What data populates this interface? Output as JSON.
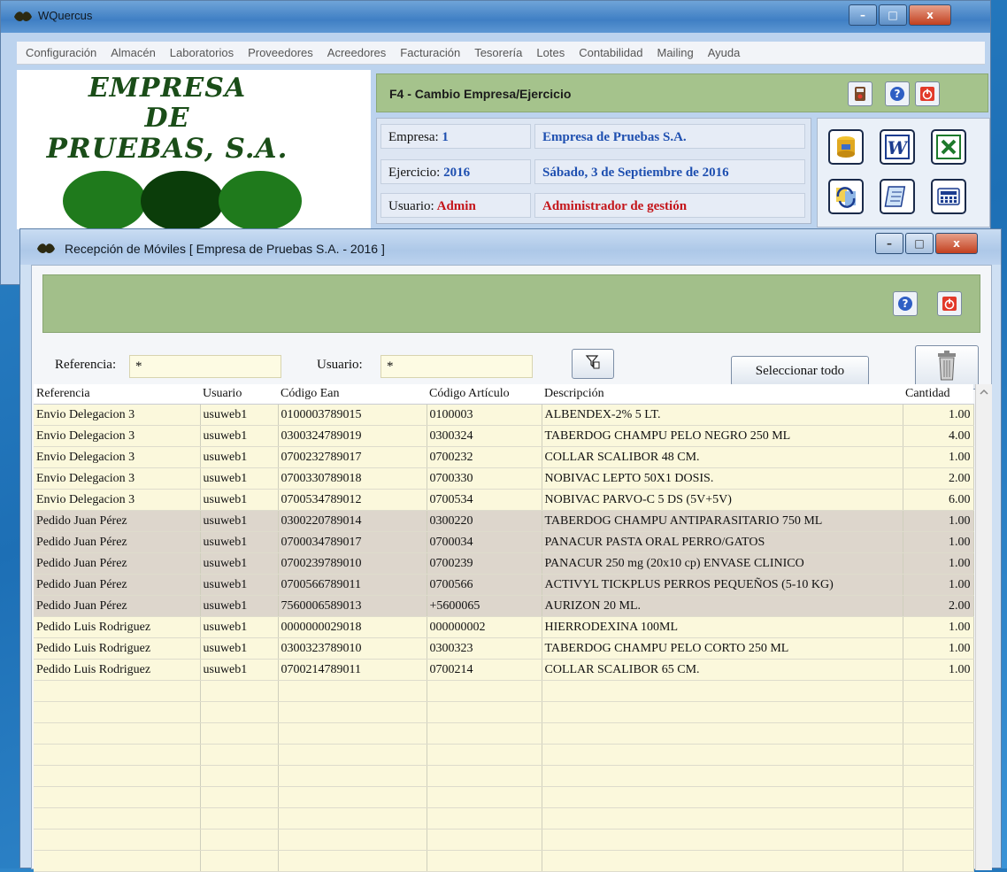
{
  "main_window": {
    "title": "WQuercus",
    "controls": {
      "minimize": "–",
      "maximize": "□",
      "close": "x"
    }
  },
  "menu": [
    "Configuración",
    "Almacén",
    "Laboratorios",
    "Proveedores",
    "Acreedores",
    "Facturación",
    "Tesorería",
    "Lotes",
    "Contabilidad",
    "Mailing",
    "Ayuda"
  ],
  "company_logo": {
    "line1": "EMPRESA",
    "line2": "DE",
    "line3": "PRUEBAS, S.A."
  },
  "header_bar": {
    "label": "F4 - Cambio Empresa/Ejercicio"
  },
  "session": {
    "empresa_label": "Empresa:",
    "empresa_code": "1",
    "empresa_name": "Empresa de Pruebas S.A.",
    "ejercicio_label": "Ejercicio:",
    "ejercicio_value": "2016",
    "fecha": "Sábado, 3 de Septiembre de 2016",
    "usuario_label": "Usuario:",
    "usuario_value": "Admin",
    "usuario_desc": "Administrador de gestión"
  },
  "child_window": {
    "title": "Recepción de Móviles [ Empresa de Pruebas S.A. - 2016 ]"
  },
  "filters": {
    "referencia_label": "Referencia:",
    "referencia_value": "*",
    "usuario_label": "Usuario:",
    "usuario_value": "*",
    "select_all_label": "Seleccionar todo"
  },
  "table": {
    "columns": [
      "Referencia",
      "Usuario",
      "Código Ean",
      "Código Artículo",
      "Descripción",
      "Cantidad"
    ],
    "rows": [
      {
        "group": "del",
        "cells": [
          "Envio Delegacion 3",
          "usuweb1",
          "0100003789015",
          "0100003",
          "ALBENDEX-2% 5 LT.",
          "1.00"
        ]
      },
      {
        "group": "del",
        "cells": [
          "Envio Delegacion 3",
          "usuweb1",
          "0300324789019",
          "0300324",
          "TABERDOG CHAMPU PELO NEGRO 250 ML",
          "4.00"
        ]
      },
      {
        "group": "del",
        "cells": [
          "Envio Delegacion 3",
          "usuweb1",
          "0700232789017",
          "0700232",
          "COLLAR SCALIBOR 48 CM.",
          "1.00"
        ]
      },
      {
        "group": "del",
        "cells": [
          "Envio Delegacion 3",
          "usuweb1",
          "0700330789018",
          "0700330",
          "NOBIVAC LEPTO 50X1 DOSIS.",
          "2.00"
        ]
      },
      {
        "group": "del",
        "cells": [
          "Envio Delegacion 3",
          "usuweb1",
          "0700534789012",
          "0700534",
          "NOBIVAC PARVO-C 5 DS (5V+5V)",
          "6.00"
        ]
      },
      {
        "group": "juan",
        "cells": [
          "Pedido Juan Pérez",
          "usuweb1",
          "0300220789014",
          "0300220",
          "TABERDOG CHAMPU ANTIPARASITARIO 750 ML",
          "1.00"
        ]
      },
      {
        "group": "juan",
        "cells": [
          "Pedido Juan Pérez",
          "usuweb1",
          "0700034789017",
          "0700034",
          "PANACUR PASTA ORAL PERRO/GATOS",
          "1.00"
        ]
      },
      {
        "group": "juan",
        "cells": [
          "Pedido Juan Pérez",
          "usuweb1",
          "0700239789010",
          "0700239",
          "PANACUR 250 mg (20x10 cp) ENVASE CLINICO",
          "1.00"
        ]
      },
      {
        "group": "juan",
        "cells": [
          "Pedido Juan Pérez",
          "usuweb1",
          "0700566789011",
          "0700566",
          "ACTIVYL TICKPLUS PERROS PEQUEÑOS (5-10 KG)",
          "1.00"
        ]
      },
      {
        "group": "juan",
        "cells": [
          "Pedido Juan Pérez",
          "usuweb1",
          "7560006589013",
          "+5600065",
          "AURIZON 20 ML.",
          "2.00"
        ]
      },
      {
        "group": "luis",
        "cells": [
          "Pedido Luis  Rodriguez",
          "usuweb1",
          "0000000029018",
          "000000002",
          "HIERRODEXINA 100ML",
          "1.00"
        ]
      },
      {
        "group": "luis",
        "cells": [
          "Pedido Luis  Rodriguez",
          "usuweb1",
          "0300323789010",
          "0300323",
          "TABERDOG CHAMPU PELO CORTO 250 ML",
          "1.00"
        ]
      },
      {
        "group": "luis",
        "cells": [
          "Pedido Luis  Rodriguez",
          "usuweb1",
          "0700214789011",
          "0700214",
          "COLLAR SCALIBOR 65 CM.",
          "1.00"
        ]
      }
    ]
  },
  "colors": {
    "green_bar": "#a2bf8a",
    "row_yellow": "#fbf8dc",
    "row_grey": "#ddd6cc",
    "value_blue": "#1e4fb0",
    "value_red": "#c4151a"
  }
}
